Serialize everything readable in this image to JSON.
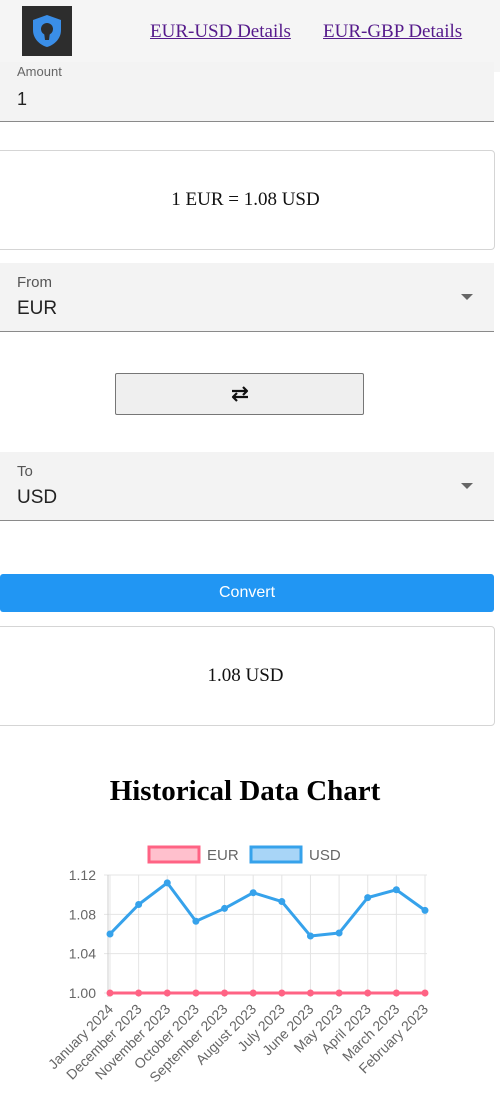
{
  "header": {
    "logo_icon": "shield-keyhole-icon",
    "links": [
      "EUR-USD Details",
      "EUR-GBP Details"
    ]
  },
  "amount": {
    "label": "Amount",
    "value": "1"
  },
  "rate_text": "1 EUR = 1.08 USD",
  "from": {
    "label": "From",
    "value": "EUR"
  },
  "swap_icon": "swap-arrows-icon",
  "to": {
    "label": "To",
    "value": "USD"
  },
  "convert_label": "Convert",
  "result_text": "1.08 USD",
  "chart_data": {
    "type": "line",
    "title": "Historical Data Chart",
    "categories": [
      "January 2024",
      "December 2023",
      "November 2023",
      "October 2023",
      "September 2023",
      "August 2023",
      "July 2023",
      "June 2023",
      "May 2023",
      "April 2023",
      "March 2023",
      "February 2023"
    ],
    "series": [
      {
        "name": "EUR",
        "values": [
          1,
          1,
          1,
          1,
          1,
          1,
          1,
          1,
          1,
          1,
          1,
          1
        ],
        "color": "#ff6384"
      },
      {
        "name": "USD",
        "values": [
          1.06,
          1.09,
          1.112,
          1.073,
          1.086,
          1.102,
          1.093,
          1.058,
          1.061,
          1.097,
          1.105,
          1.084
        ],
        "color": "#36a2eb"
      }
    ],
    "y_ticks": [
      "1.12",
      "1.08",
      "1.04",
      "1.00"
    ],
    "ylim": [
      1.0,
      1.12
    ],
    "legend": "top",
    "grid": true
  }
}
